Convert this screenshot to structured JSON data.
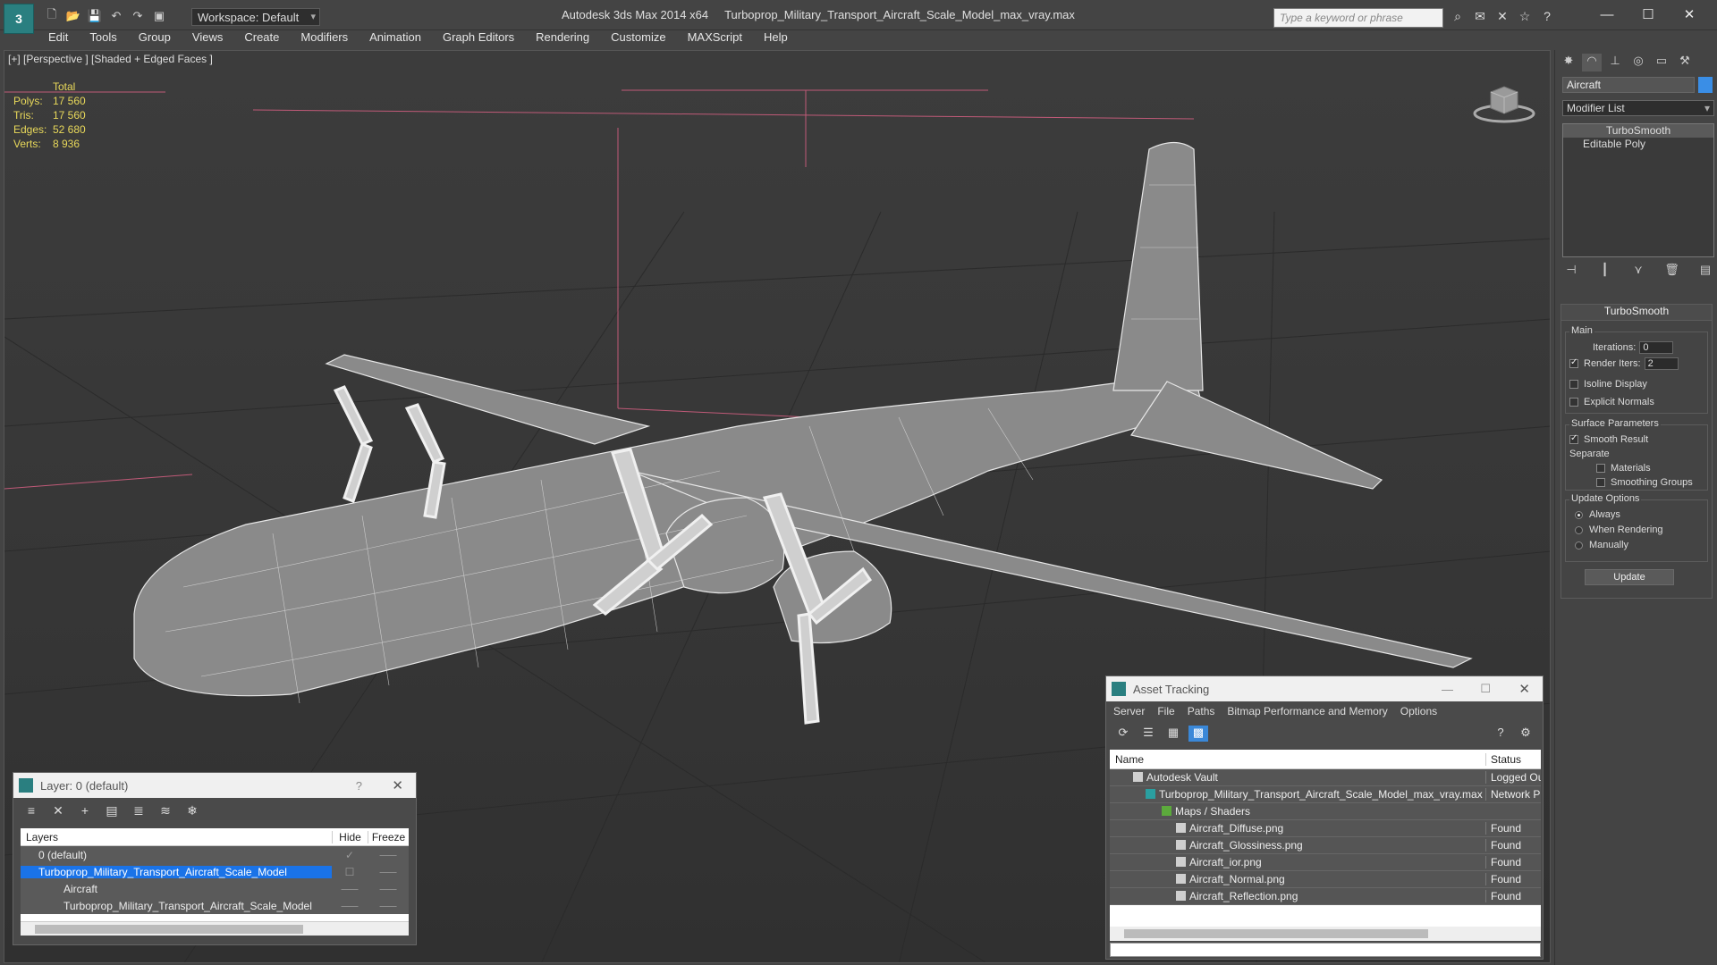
{
  "window": {
    "app_title": "Autodesk 3ds Max  2014 x64",
    "file_name": "Turboprop_Military_Transport_Aircraft_Scale_Model_max_vray.max",
    "workspace": "Workspace: Default",
    "search_placeholder": "Type a keyword or phrase"
  },
  "menu": [
    "Edit",
    "Tools",
    "Group",
    "Views",
    "Create",
    "Modifiers",
    "Animation",
    "Graph Editors",
    "Rendering",
    "Customize",
    "MAXScript",
    "Help"
  ],
  "viewport": {
    "label": "[+] [Perspective ] [Shaded + Edged Faces ]",
    "stats": {
      "header": "Total",
      "rows": [
        {
          "key": "Polys:",
          "value": "17 560"
        },
        {
          "key": "Tris:",
          "value": "17 560"
        },
        {
          "key": "Edges:",
          "value": "52 680"
        },
        {
          "key": "Verts:",
          "value": "8 936"
        }
      ]
    }
  },
  "layer_panel": {
    "title": "Layer: 0 (default)",
    "help": "?",
    "columns": {
      "name": "Layers",
      "hide": "Hide",
      "freeze": "Freeze"
    },
    "rows": [
      {
        "name": "0 (default)",
        "hide": "✓",
        "freeze": "⸺"
      },
      {
        "name": "Turboprop_Military_Transport_Aircraft_Scale_Model",
        "hide": "☐",
        "freeze": "⸺"
      },
      {
        "name": "Aircraft",
        "hide": "⸺",
        "freeze": "⸺"
      },
      {
        "name": "Turboprop_Military_Transport_Aircraft_Scale_Model",
        "hide": "⸺",
        "freeze": "⸺"
      }
    ]
  },
  "asset_panel": {
    "title": "Asset Tracking",
    "menu": [
      "Server",
      "File",
      "Paths",
      "Bitmap Performance and Memory",
      "Options"
    ],
    "columns": {
      "name": "Name",
      "status": "Status"
    },
    "rows": [
      {
        "name": "Autodesk Vault",
        "status": "Logged Ou",
        "indent": 1
      },
      {
        "name": "Turboprop_Military_Transport_Aircraft_Scale_Model_max_vray.max",
        "status": "Network P",
        "indent": 2
      },
      {
        "name": "Maps / Shaders",
        "status": "",
        "indent": 3
      },
      {
        "name": "Aircraft_Diffuse.png",
        "status": "Found",
        "indent": 4
      },
      {
        "name": "Aircraft_Glossiness.png",
        "status": "Found",
        "indent": 4
      },
      {
        "name": "Aircraft_ior.png",
        "status": "Found",
        "indent": 4
      },
      {
        "name": "Aircraft_Normal.png",
        "status": "Found",
        "indent": 4
      },
      {
        "name": "Aircraft_Reflection.png",
        "status": "Found",
        "indent": 4
      }
    ]
  },
  "command_panel": {
    "object_name": "Aircraft",
    "object_color": "#3a8ee6",
    "modifier_list": "Modifier List",
    "stack": [
      "TurboSmooth",
      "Editable Poly"
    ],
    "rollout_title": "TurboSmooth",
    "main_label": "Main",
    "iterations_label": "Iterations:",
    "iterations_value": "0",
    "render_iters_label": "Render Iters:",
    "render_iters_value": "2",
    "isoline": "Isoline Display",
    "explicit": "Explicit Normals",
    "surface_label": "Surface Parameters",
    "smooth_result": "Smooth Result",
    "separate_label": "Separate",
    "materials": "Materials",
    "smoothing_groups": "Smoothing Groups",
    "update_label": "Update Options",
    "always": "Always",
    "when_rendering": "When Rendering",
    "manually": "Manually",
    "update_btn": "Update"
  }
}
